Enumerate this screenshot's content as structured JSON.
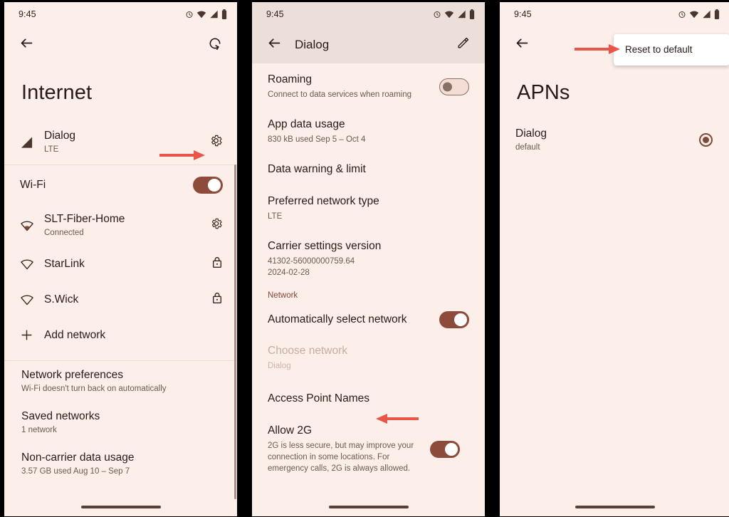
{
  "theme": {
    "background": "#fceee8",
    "appbar_dark": "#ecdfda",
    "accent": "#8d4c3b",
    "text_primary": "#2a1a16",
    "text_secondary": "#6d5953",
    "section_caption": "#87453a",
    "arrow_red": "#e8564a",
    "popup_background": "#ffffff"
  },
  "panel1": {
    "status": {
      "time": "9:45",
      "icons": [
        "alarm-icon",
        "wifi-icon",
        "signal-icon",
        "battery-icon"
      ]
    },
    "appbar": {
      "back_icon": "back-arrow-icon",
      "action_icon": "reset-icon"
    },
    "page_title": "Internet",
    "carrier": {
      "icon": "signal-bars-icon",
      "name": "Dialog",
      "sub": "LTE",
      "settings_icon": "gear-icon"
    },
    "wifi": {
      "label": "Wi-Fi",
      "enabled": true
    },
    "networks": [
      {
        "icon": "wifi-connected-icon",
        "name": "SLT-Fiber-Home",
        "sub": "Connected",
        "trail": "gear-icon"
      },
      {
        "icon": "wifi-icon",
        "name": "StarLink",
        "sub": "",
        "trail": "lock-icon"
      },
      {
        "icon": "wifi-icon",
        "name": "S.Wick",
        "sub": "",
        "trail": "lock-icon"
      }
    ],
    "add_network": {
      "icon": "plus-icon",
      "label": "Add network"
    },
    "preferences": [
      {
        "title": "Network preferences",
        "sub": "Wi-Fi doesn't turn back on automatically"
      },
      {
        "title": "Saved networks",
        "sub": "1 network"
      },
      {
        "title": "Non-carrier data usage",
        "sub": "3.57 GB used Aug 10 – Sep 7"
      }
    ]
  },
  "panel2": {
    "status": {
      "time": "9:45",
      "icons": [
        "alarm-icon",
        "wifi-icon",
        "signal-icon",
        "battery-icon"
      ]
    },
    "appbar": {
      "back_icon": "back-arrow-icon",
      "title": "Dialog",
      "action_icon": "pencil-icon"
    },
    "items": [
      {
        "title": "Roaming",
        "sub": "Connect to data services when roaming",
        "toggle": false
      },
      {
        "title": "App data usage",
        "sub": "830 kB used Sep 5 – Oct 4"
      },
      {
        "title": "Data warning & limit",
        "sub": ""
      },
      {
        "title": "Preferred network type",
        "sub": "LTE"
      },
      {
        "title": "Carrier settings version",
        "sub": "41302-56000000759.64\n2024-02-28"
      }
    ],
    "section_caption": "Network",
    "network_items": [
      {
        "title": "Automatically select network",
        "sub": "",
        "toggle": true
      },
      {
        "title": "Choose network",
        "sub": "Dialog",
        "disabled": true
      },
      {
        "title": "Access Point Names",
        "sub": ""
      },
      {
        "title": "Allow 2G",
        "sub": "2G is less secure, but may improve your connection in some locations. For emergency calls, 2G is always allowed.",
        "toggle": true
      }
    ]
  },
  "panel3": {
    "status": {
      "time": "9:45",
      "icons": [
        "alarm-icon",
        "wifi-icon",
        "signal-icon",
        "battery-icon"
      ]
    },
    "appbar": {
      "back_icon": "back-arrow-icon"
    },
    "popup_menu": {
      "items": [
        "Reset to default"
      ]
    },
    "page_title": "APNs",
    "apns": [
      {
        "name": "Dialog",
        "sub": "default",
        "selected": true
      }
    ]
  },
  "annotations": [
    {
      "name": "arrow-to-carrier-settings",
      "target": "gear-icon"
    },
    {
      "name": "arrow-to-access-point-names",
      "target": "Access Point Names"
    },
    {
      "name": "arrow-to-reset-to-default",
      "target": "Reset to default"
    }
  ]
}
